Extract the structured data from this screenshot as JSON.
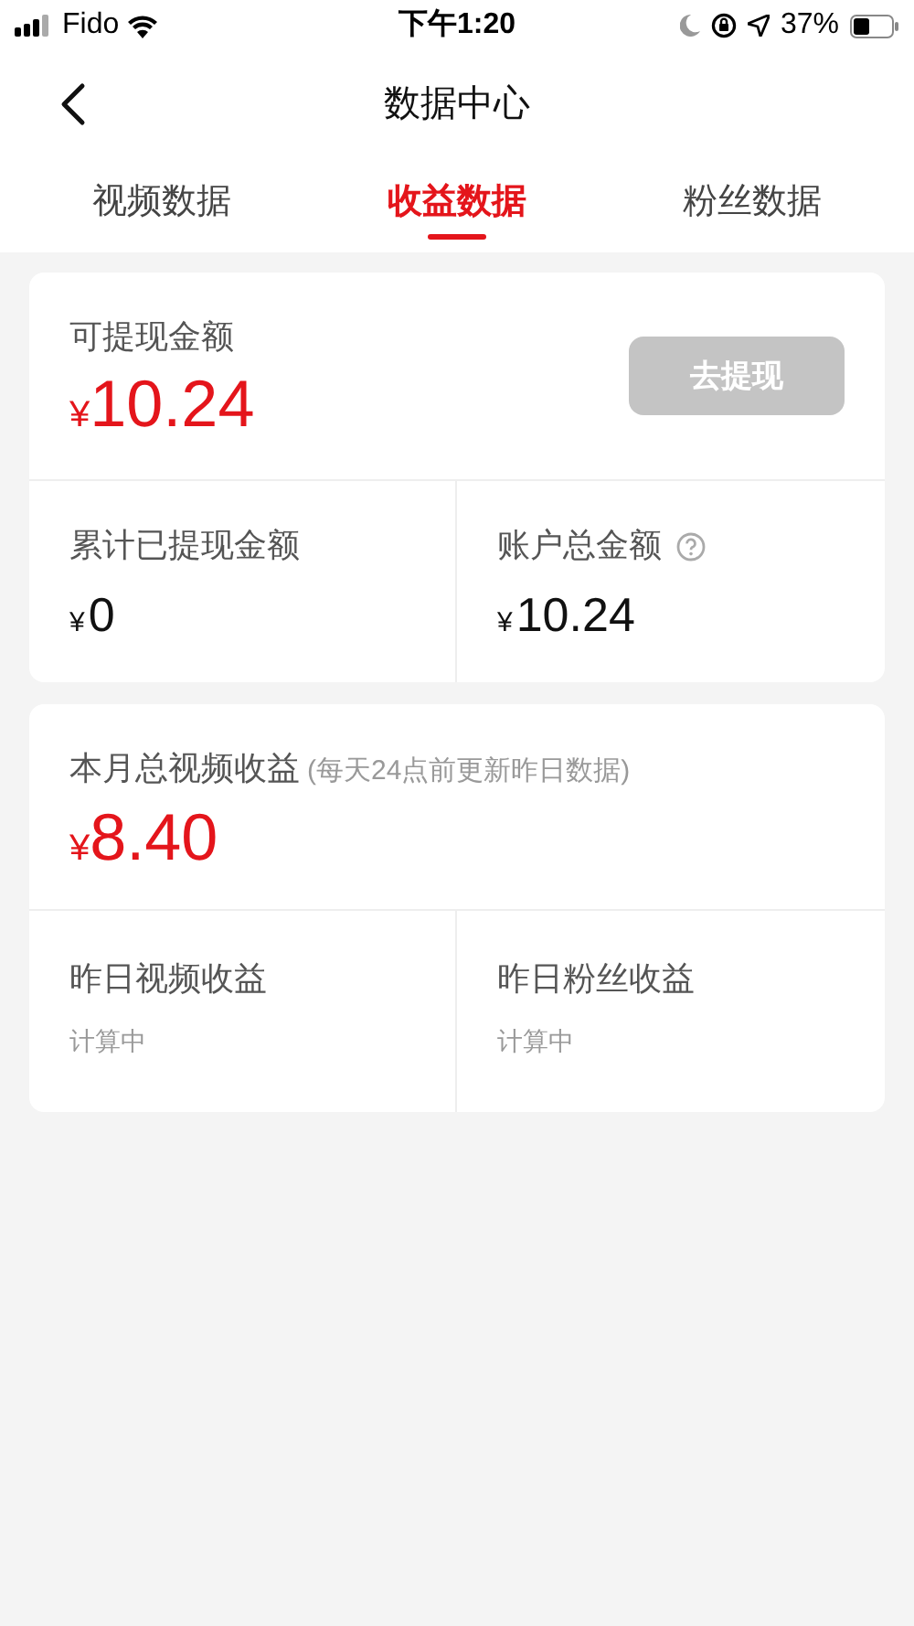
{
  "status_bar": {
    "carrier": "Fido",
    "time": "下午1:20",
    "battery": "37%"
  },
  "nav": {
    "title": "数据中心"
  },
  "tabs": [
    {
      "label": "视频数据",
      "selected": false
    },
    {
      "label": "收益数据",
      "selected": true
    },
    {
      "label": "粉丝数据",
      "selected": false
    }
  ],
  "withdrawable": {
    "label": "可提现金额",
    "currency": "¥",
    "amount": "10.24",
    "button": {
      "label": "去提现",
      "disabled": true
    }
  },
  "balances": [
    {
      "label": "累计已提现金额",
      "currency": "¥",
      "amount": "0",
      "help": false
    },
    {
      "label": "账户总金额",
      "currency": "¥",
      "amount": "10.24",
      "help": true
    }
  ],
  "monthly": {
    "label": "本月总视频收益",
    "note": "(每天24点前更新昨日数据)",
    "currency": "¥",
    "amount": "8.40"
  },
  "yesterday": [
    {
      "label": "昨日视频收益",
      "value": "计算中"
    },
    {
      "label": "昨日粉丝收益",
      "value": "计算中"
    }
  ]
}
